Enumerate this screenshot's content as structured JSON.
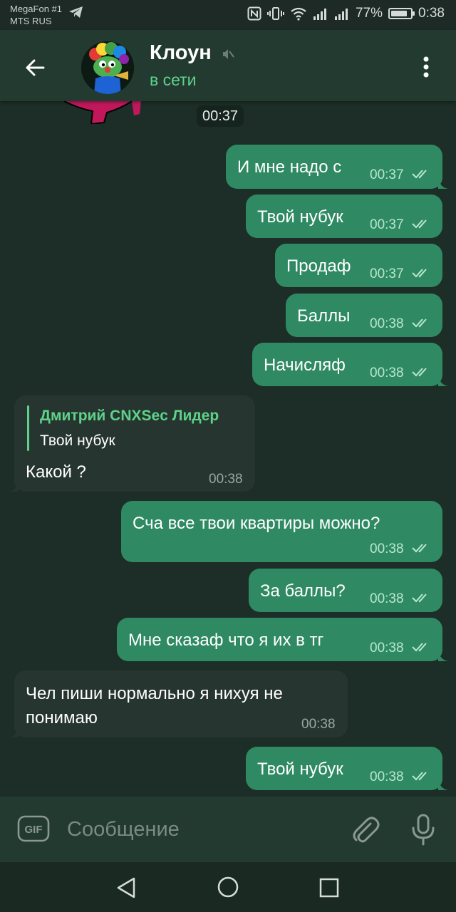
{
  "status_bar": {
    "carrier_1": "MegaFon #1",
    "carrier_2": "MTS RUS",
    "battery": "77%",
    "time": "0:38"
  },
  "header": {
    "title": "Клоун",
    "status": "в сети"
  },
  "date_chip": "00:37",
  "messages": [
    {
      "direction": "out",
      "text": "И мне надо с",
      "time": "00:37"
    },
    {
      "direction": "out",
      "text": "Твой нубук",
      "time": "00:37"
    },
    {
      "direction": "out",
      "text": "Продаф",
      "time": "00:37"
    },
    {
      "direction": "out",
      "text": "Баллы",
      "time": "00:38"
    },
    {
      "direction": "out",
      "text": "Начисляф",
      "time": "00:38"
    },
    {
      "direction": "in",
      "reply_name": "Дмитрий CNXSec Лидер",
      "reply_text": "Твой нубук",
      "text": "Какой ?",
      "time": "00:38"
    },
    {
      "direction": "out",
      "text": "Сча все твои квартиры можно?",
      "time": "00:38"
    },
    {
      "direction": "out",
      "text": "За баллы?",
      "time": "00:38"
    },
    {
      "direction": "out",
      "text": "Мне сказаф что я их в тг",
      "time": "00:38"
    },
    {
      "direction": "in",
      "text_line1": "Чел пиши нормально я нихуя не",
      "text_line2": "понимаю",
      "time": "00:38"
    },
    {
      "direction": "out",
      "text": "Твой нубук",
      "time": "00:38"
    }
  ],
  "input": {
    "gif_label": "GIF",
    "placeholder": "Сообщение"
  },
  "colors": {
    "background": "#1c2e27",
    "header": "#233a31",
    "outgoing_bubble": "#2f8a63",
    "incoming_bubble": "#26352f",
    "accent": "#5ed28a"
  },
  "icons": [
    "back-arrow-icon",
    "mute-icon",
    "more-vert-icon",
    "double-check-icon",
    "gif-icon",
    "paperclip-icon",
    "microphone-icon",
    "nav-back-icon",
    "nav-home-icon",
    "nav-recent-icon"
  ]
}
